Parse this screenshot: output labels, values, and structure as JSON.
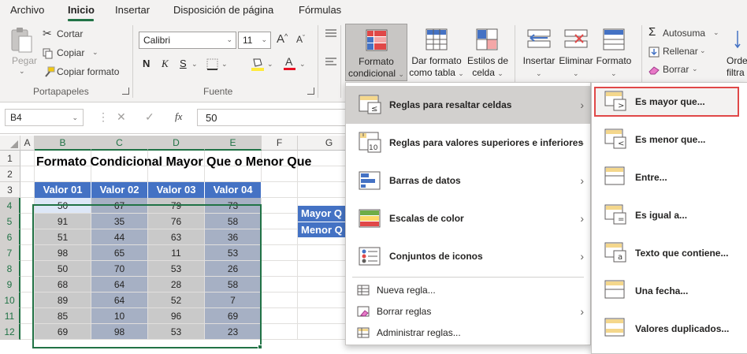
{
  "tabs": [
    "Archivo",
    "Inicio",
    "Insertar",
    "Disposición de página",
    "Fórmulas"
  ],
  "active_tab": "Inicio",
  "ribbon": {
    "clipboard": {
      "paste": "Pegar",
      "cut": "Cortar",
      "copy": "Copiar",
      "format_painter": "Copiar formato",
      "group_label": "Portapapeles"
    },
    "font": {
      "font_name": "Calibri",
      "font_size": "11",
      "bold": "N",
      "italic": "K",
      "underline": "S",
      "grow": "A",
      "shrink": "A",
      "group_label": "Fuente",
      "font_color_hex": "#e81123",
      "highlight_hex": "#ffeb3b"
    },
    "styles": {
      "conditional_format": [
        "Formato",
        "condicional"
      ],
      "format_as_table": [
        "Dar formato",
        "como tabla"
      ],
      "cell_styles": [
        "Estilos de",
        "celda"
      ]
    },
    "cells": {
      "insert": "Insertar",
      "delete": "Eliminar",
      "format": "Formato"
    },
    "editing": {
      "autosum": "Autosuma",
      "fill": "Rellenar",
      "clear": "Borrar",
      "sort_partial": [
        "Orde",
        "filtra"
      ]
    }
  },
  "formula_bar": {
    "name_box": "B4",
    "fx": "fx",
    "cancel": "✕",
    "enter": "✓",
    "value": "50"
  },
  "sheet": {
    "columns": [
      "A",
      "B",
      "C",
      "D",
      "E",
      "F",
      "G"
    ],
    "rows": [
      "1",
      "2",
      "3",
      "4",
      "5",
      "6",
      "7",
      "8",
      "9",
      "10",
      "11",
      "12"
    ],
    "title": "Formato Condicional Mayor Que o Menor Que",
    "table_headers": [
      "Valor 01",
      "Valor 02",
      "Valor 03",
      "Valor 04"
    ],
    "table": [
      [
        "50",
        "67",
        "79",
        "73"
      ],
      [
        "91",
        "35",
        "76",
        "58"
      ],
      [
        "51",
        "44",
        "63",
        "36"
      ],
      [
        "98",
        "65",
        "11",
        "53"
      ],
      [
        "50",
        "70",
        "53",
        "26"
      ],
      [
        "68",
        "64",
        "28",
        "58"
      ],
      [
        "89",
        "64",
        "52",
        "7"
      ],
      [
        "85",
        "10",
        "96",
        "69"
      ],
      [
        "69",
        "98",
        "53",
        "23"
      ]
    ],
    "side_labels": [
      "Mayor Q",
      "Menor Q"
    ],
    "header_fill": "#4472c4",
    "cell_fill_light": "#c9c9c9",
    "cell_fill_dark": "#a6b0c4",
    "active_cell_fill": "#dde7f7"
  },
  "menu": {
    "items": [
      {
        "label": "Reglas para resaltar celdas",
        "arrow": "›"
      },
      {
        "label": "Reglas para valores superiores e inferiores",
        "arrow": "›"
      },
      {
        "label": "Barras de datos",
        "arrow": "›"
      },
      {
        "label": "Escalas de color",
        "arrow": "›"
      },
      {
        "label": "Conjuntos de iconos",
        "arrow": "›"
      }
    ],
    "small_items": [
      {
        "label": "Nueva regla..."
      },
      {
        "label": "Borrar reglas",
        "arrow": "›"
      },
      {
        "label": "Administrar reglas..."
      }
    ]
  },
  "submenu": {
    "items": [
      {
        "label": "Es mayor que..."
      },
      {
        "label": "Es menor que..."
      },
      {
        "label": "Entre..."
      },
      {
        "label": "Es igual a..."
      },
      {
        "label": "Texto que contiene..."
      },
      {
        "label": "Una fecha..."
      },
      {
        "label": "Valores duplicados..."
      }
    ],
    "highlight_color": "#e04848"
  }
}
